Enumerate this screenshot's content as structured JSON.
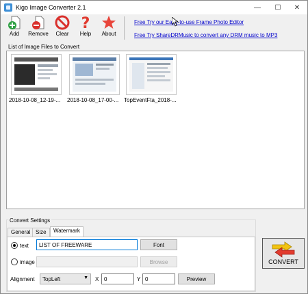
{
  "window": {
    "title": "Kigo Image Converter 2.1",
    "controls": {
      "minimize": "—",
      "maximize": "☐",
      "close": "✕"
    }
  },
  "toolbar": {
    "buttons": [
      {
        "label": "Add",
        "icon": "add-icon"
      },
      {
        "label": "Remove",
        "icon": "remove-icon"
      },
      {
        "label": "Clear",
        "icon": "clear-icon"
      },
      {
        "label": "Help",
        "icon": "help-icon"
      },
      {
        "label": "About",
        "icon": "about-icon"
      }
    ],
    "links": [
      "Free Try our Easy-to-use Frame Photo Editor",
      "Free Try ShareDRMusic to convert any DRM music to MP3"
    ]
  },
  "file_list": {
    "label": "List of Image Files to Convert",
    "items": [
      {
        "name": "2018-10-08_12-19-..."
      },
      {
        "name": "2018-10-08_17-00-..."
      },
      {
        "name": "TopEventFta_2018-..."
      }
    ]
  },
  "settings": {
    "title": "Convert Settings",
    "tabs": [
      "General",
      "Size",
      "Watermark"
    ],
    "active_tab": "Watermark",
    "text_option": {
      "label": "text",
      "checked": true,
      "value": "LIST OF FREEWARE"
    },
    "font_button": "Font",
    "image_option": {
      "label": "image",
      "checked": false,
      "value": ""
    },
    "browse_button": "Browse",
    "alignment": {
      "label": "Alignment",
      "value": "TopLeft"
    },
    "x": {
      "label": "X",
      "value": "0"
    },
    "y": {
      "label": "Y",
      "value": "0"
    },
    "preview_button": "Preview"
  },
  "convert_button": {
    "label": "CONVERT",
    "icon": "convert-arrows-icon"
  },
  "colors": {
    "link": "#0000cc",
    "accent_focus": "#0078d7",
    "add_green": "#2ea043",
    "remove_red": "#d9302c",
    "help_red": "#e03a2f",
    "about_red": "#e8443a"
  }
}
